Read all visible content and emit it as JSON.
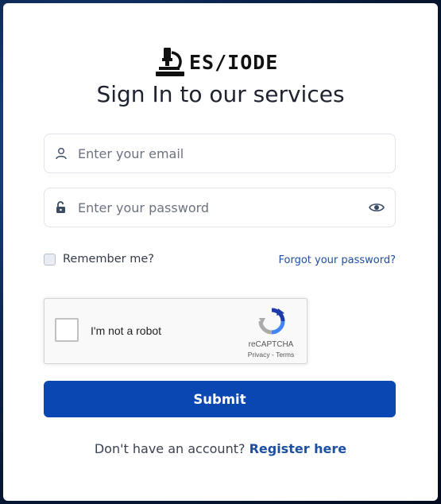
{
  "brand": {
    "logo_text": "ES/IODE"
  },
  "page": {
    "title": "Sign In to our services"
  },
  "form": {
    "email_placeholder": "Enter your email",
    "password_placeholder": "Enter your password",
    "remember_label": "Remember me?",
    "remember_checked": false,
    "forgot_label": "Forgot your password?",
    "submit_label": "Submit"
  },
  "recaptcha": {
    "label": "I'm not a robot",
    "brand": "reCAPTCHA",
    "privacy": "Privacy",
    "separator": " - ",
    "terms": "Terms"
  },
  "footer": {
    "prompt": "Don't have an account? ",
    "register_label": "Register here"
  },
  "colors": {
    "primary": "#0b47b3",
    "link": "#1d4fa3",
    "icon": "#3d4a63"
  },
  "icons": {
    "logo": "microscope-icon",
    "email": "user-icon",
    "password": "unlock-icon",
    "toggle": "eye-icon"
  }
}
